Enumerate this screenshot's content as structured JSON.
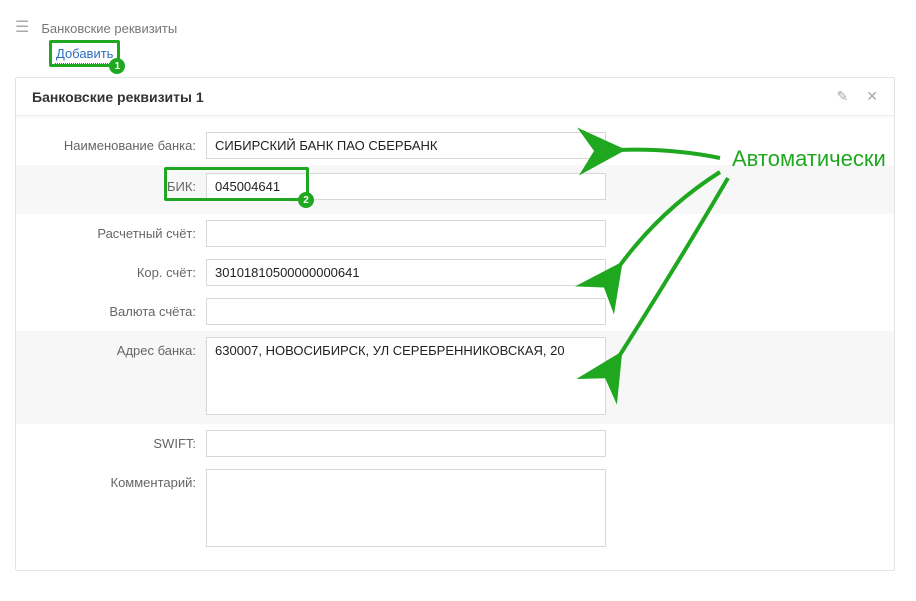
{
  "header": {
    "title": "Банковские реквизиты"
  },
  "actions": {
    "add_label": "Добавить"
  },
  "panel": {
    "title": "Банковские реквизиты 1"
  },
  "fields": {
    "bank_name": {
      "label": "Наименование банка:",
      "value": "СИБИРСКИЙ БАНК ПАО СБЕРБАНК"
    },
    "bik": {
      "label": "БИК:",
      "value": "045004641"
    },
    "account": {
      "label": "Расчетный счёт:",
      "value": ""
    },
    "corr": {
      "label": "Кор. счёт:",
      "value": "30101810500000000641"
    },
    "currency": {
      "label": "Валюта счёта:",
      "value": ""
    },
    "address": {
      "label": "Адрес банка:",
      "value": "630007, НОВОСИБИРСК, УЛ СЕРЕБРЕННИКОВСКАЯ, 20"
    },
    "swift": {
      "label": "SWIFT:",
      "value": ""
    },
    "comment": {
      "label": "Комментарий:",
      "value": ""
    }
  },
  "annotation": {
    "auto_label": "Автоматически",
    "badge1": "1",
    "badge2": "2"
  }
}
